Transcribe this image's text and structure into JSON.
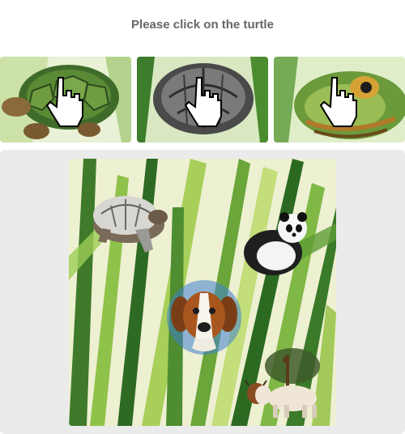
{
  "captcha": {
    "prompt": "Please click on the turtle",
    "examples": [
      {
        "icon": "turtle-shell-green-icon"
      },
      {
        "icon": "turtle-shell-grey-icon"
      },
      {
        "icon": "turtle-head-icon"
      }
    ],
    "objects": [
      "turtle",
      "panda",
      "dog",
      "cow"
    ]
  },
  "colors": {
    "prompt_text": "#666666",
    "panel_bg": "#ebebeb",
    "leaf_green": "#6aa63a",
    "leaf_dark": "#2f6a24"
  }
}
